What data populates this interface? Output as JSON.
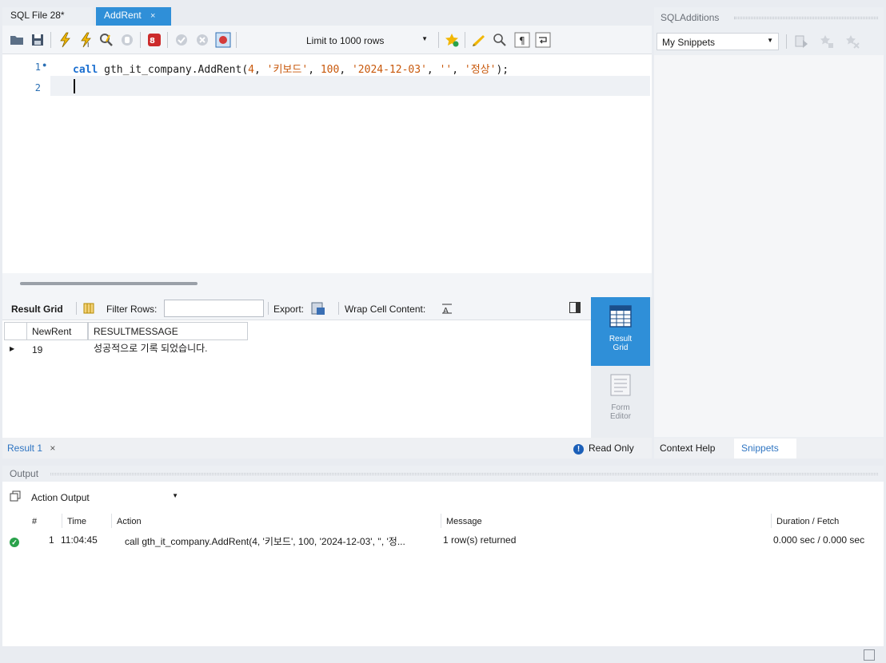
{
  "editor_tabs": {
    "file_tab": "SQL File 28*",
    "active_tab": "AddRent",
    "close_glyph": "×"
  },
  "toolbar": {
    "limit_label": "Limit to 1000 rows",
    "icons": [
      "open-folder-icon",
      "save-icon",
      "execute-icon",
      "execute-current-icon",
      "explain-icon",
      "stop-icon",
      "toggle-autocommit-icon",
      "commit-icon",
      "rollback-icon",
      "toggle-stop-on-error-icon",
      "bookmark-add-icon",
      "beautify-icon",
      "find-icon",
      "invisible-chars-icon",
      "wrap-icon"
    ]
  },
  "editor": {
    "lines": [
      {
        "number": "1",
        "marker": "●",
        "tokens": [
          {
            "text": "call",
            "cls": "kw"
          },
          {
            "text": " gth_it_company.AddRent(",
            "cls": ""
          },
          {
            "text": "4",
            "cls": "num"
          },
          {
            "text": ", ",
            "cls": ""
          },
          {
            "text": "'키보드'",
            "cls": "str"
          },
          {
            "text": ", ",
            "cls": ""
          },
          {
            "text": "100",
            "cls": "num"
          },
          {
            "text": ", ",
            "cls": ""
          },
          {
            "text": "'2024-12-03'",
            "cls": "str"
          },
          {
            "text": ", ",
            "cls": ""
          },
          {
            "text": "''",
            "cls": "str"
          },
          {
            "text": ", ",
            "cls": ""
          },
          {
            "text": "'정상'",
            "cls": "str"
          },
          {
            "text": ");",
            "cls": ""
          }
        ]
      },
      {
        "number": "2",
        "marker": "",
        "tokens": []
      }
    ]
  },
  "result_toolbar": {
    "result_grid_label": "Result Grid",
    "filter_label": "Filter Rows:",
    "filter_value": "",
    "export_label": "Export:",
    "wrap_label": "Wrap Cell Content:"
  },
  "grid": {
    "columns": [
      "NewRent",
      "RESULTMESSAGE"
    ],
    "rows": [
      [
        "19",
        "성공적으로 기록 되었습니다."
      ]
    ]
  },
  "side_panel": {
    "result_grid": "Result Grid",
    "form_editor": "Form Editor"
  },
  "result_footer": {
    "tab_label": "Result 1",
    "close_glyph": "×",
    "read_only": "Read Only",
    "info_glyph": "!"
  },
  "additions": {
    "title": "SQLAdditions",
    "snippet_select": "My Snippets",
    "tab_context_help": "Context Help",
    "tab_snippets": "Snippets"
  },
  "output": {
    "title": "Output",
    "select_value": "Action Output",
    "headers": [
      "#",
      "Time",
      "Action",
      "Message",
      "Duration / Fetch"
    ],
    "rows": [
      {
        "index": "1",
        "time": "11:04:45",
        "action": "call gth_it_company.AddRent(4, '키보드', 100, '2024-12-03', '', '정...",
        "message": "1 row(s) returned",
        "duration": "0.000 sec / 0.000 sec",
        "status": "success"
      }
    ]
  },
  "colors": {
    "accent": "#2f8fd8",
    "success": "#2aa24b",
    "keyword": "#1b6fd0",
    "literal": "#c8580b"
  }
}
